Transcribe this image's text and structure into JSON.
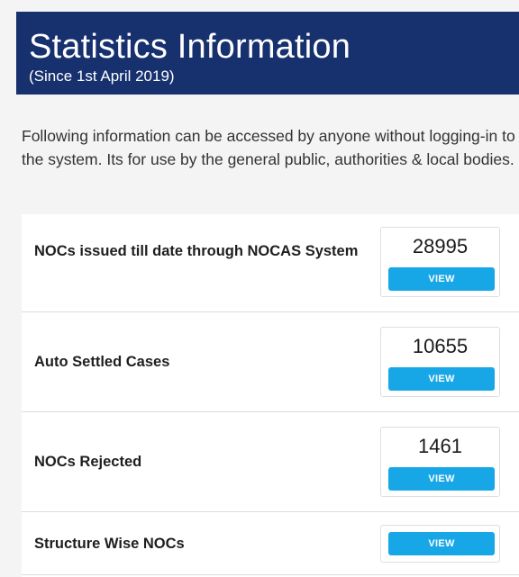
{
  "header": {
    "title": "Statistics Information",
    "subtitle": "(Since 1st April 2019)"
  },
  "intro": {
    "text": "Following information can be accessed by anyone without logging-in to the system. Its for use by the general public, authorities & local bodies."
  },
  "stats": [
    {
      "label": "NOCs issued till date through NOCAS System",
      "count": "28995",
      "button": "VIEW"
    },
    {
      "label": "Auto Settled Cases",
      "count": "10655",
      "button": "VIEW"
    },
    {
      "label": "NOCs Rejected",
      "count": "1461",
      "button": "VIEW"
    },
    {
      "label": "Structure Wise NOCs",
      "count": "",
      "button": "VIEW"
    }
  ],
  "colors": {
    "header_bg": "#17306e",
    "button_bg": "#18a7e6"
  }
}
